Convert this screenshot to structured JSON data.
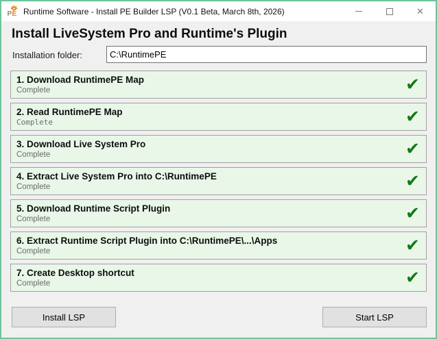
{
  "window": {
    "title": "Runtime Software - Install PE Builder LSP (V0.1 Beta, March 8th, 2026)",
    "app_icon_text": "PE",
    "controls": {
      "minimize_glyph": "—",
      "close_glyph": "✕"
    }
  },
  "header": {
    "title": "Install LiveSystem Pro and Runtime's Plugin"
  },
  "folder": {
    "label": "Installation folder:",
    "value": "C:\\RuntimePE"
  },
  "steps": [
    {
      "title": "1. Download RuntimePE Map",
      "status": "Complete",
      "mono": false
    },
    {
      "title": "2. Read RuntimePE Map",
      "status": "Complete",
      "mono": true
    },
    {
      "title": "3. Download Live System Pro",
      "status": "Complete",
      "mono": false
    },
    {
      "title": "4. Extract Live System Pro into C:\\RuntimePE",
      "status": "Complete",
      "mono": false
    },
    {
      "title": "5. Download Runtime Script Plugin",
      "status": "Complete",
      "mono": false
    },
    {
      "title": "6. Extract Runtime Script Plugin into C:\\RuntimePE\\...\\Apps",
      "status": "Complete",
      "mono": false
    },
    {
      "title": "7. Create Desktop shortcut",
      "status": "Complete",
      "mono": false
    }
  ],
  "check_glyph": "✔",
  "footer": {
    "install_label": "Install LSP",
    "start_label": "Start LSP"
  },
  "colors": {
    "window_border": "#6fc39c",
    "panel_bg": "#e9f7e9",
    "panel_border": "#a0a0a0",
    "check_green": "#157815",
    "content_bg": "#f0f0f0",
    "titlebar_bg": "#ffffff",
    "icon_orange": "#e8820c"
  }
}
